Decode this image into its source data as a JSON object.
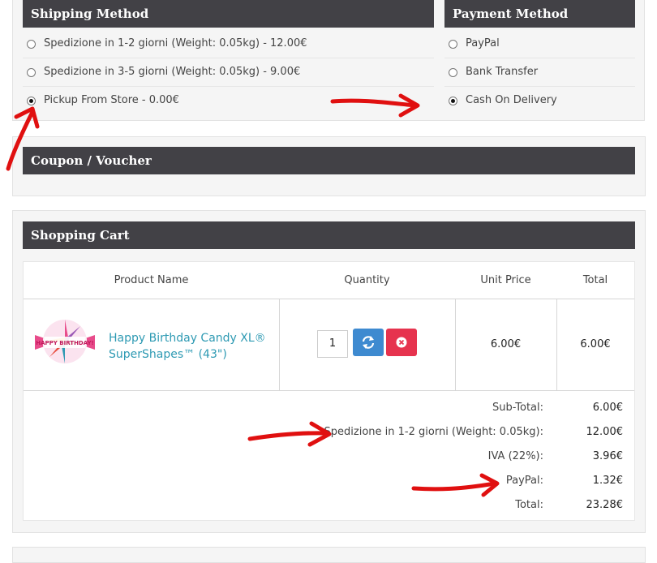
{
  "shipping": {
    "title": "Shipping Method",
    "options": [
      {
        "label": "Spedizione in 1-2 giorni (Weight: 0.05kg) - 12.00€",
        "selected": false
      },
      {
        "label": "Spedizione in 3-5 giorni (Weight: 0.05kg) - 9.00€",
        "selected": false
      },
      {
        "label": "Pickup From Store - 0.00€",
        "selected": true
      }
    ]
  },
  "payment": {
    "title": "Payment Method",
    "options": [
      {
        "label": "PayPal",
        "selected": false
      },
      {
        "label": "Bank Transfer",
        "selected": false
      },
      {
        "label": "Cash On Delivery",
        "selected": true
      }
    ]
  },
  "coupon": {
    "title": "Coupon / Voucher"
  },
  "cart": {
    "title": "Shopping Cart",
    "columns": [
      "Product Name",
      "Quantity",
      "Unit Price",
      "Total"
    ],
    "item": {
      "name_line1": "Happy Birthday Candy XL®",
      "name_line2": "SuperShapes™ (43\")",
      "image_text": "HAPPY BIRTHDAY!",
      "quantity": "1",
      "unit_price": "6.00€",
      "total": "6.00€",
      "update_icon": "refresh-icon",
      "remove_icon": "remove-circle-icon"
    },
    "totals": [
      {
        "label": "Sub-Total:",
        "value": "6.00€"
      },
      {
        "label": "Spedizione in 1-2 giorni (Weight: 0.05kg):",
        "value": "12.00€"
      },
      {
        "label": "IVA (22%):",
        "value": "3.96€"
      },
      {
        "label": "PayPal:",
        "value": "1.32€"
      },
      {
        "label": "Total:",
        "value": "23.28€"
      }
    ]
  },
  "colors": {
    "header_bg": "#424146",
    "link": "#2e9ab3",
    "update_button": "#3e8ad0",
    "remove_button": "#e6334e",
    "annotation": "#e01010"
  }
}
